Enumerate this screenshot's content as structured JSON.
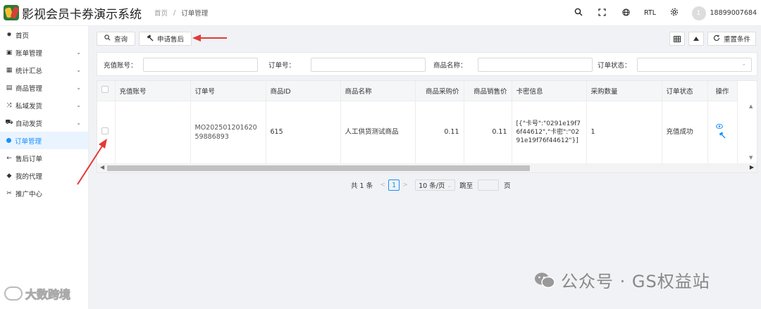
{
  "app": {
    "title": "影视会员卡券演示系统"
  },
  "breadcrumb": {
    "home": "首页",
    "sep": "/",
    "current": "订单管理"
  },
  "topbar": {
    "rtl": "RTL",
    "avatar_text": "1",
    "username": "18899007684"
  },
  "sidebar": {
    "items": [
      {
        "label": "首页",
        "icon": "home-icon",
        "glyph": "✹",
        "expandable": false
      },
      {
        "label": "账单管理",
        "icon": "bill-icon",
        "glyph": "▣",
        "expandable": true
      },
      {
        "label": "统计汇总",
        "icon": "table-icon",
        "glyph": "▦",
        "expandable": true
      },
      {
        "label": "商品管理",
        "icon": "calendar-icon",
        "glyph": "▤",
        "expandable": true
      },
      {
        "label": "私域发货",
        "icon": "shuffle-icon",
        "glyph": "⤨",
        "expandable": true
      },
      {
        "label": "自动发货",
        "icon": "truck-icon",
        "glyph": "⛟",
        "expandable": true
      },
      {
        "label": "订单管理",
        "icon": "dot-icon",
        "glyph": "",
        "expandable": false,
        "active": true
      },
      {
        "label": "售后订单",
        "icon": "arrow-left-icon",
        "glyph": "←",
        "expandable": false
      },
      {
        "label": "我的代理",
        "icon": "tag-icon",
        "glyph": "◆",
        "expandable": false
      },
      {
        "label": "推广中心",
        "icon": "gift-icon",
        "glyph": "✂",
        "expandable": false
      }
    ],
    "chevron": "⌄"
  },
  "toolbar": {
    "query_label": "查询",
    "after_sale_label": "申请售后",
    "reset_label": "重置条件"
  },
  "filters": {
    "account_label": "充值账号：",
    "order_no_label": "订单号：",
    "product_name_label": "商品名称：",
    "status_label": "订单状态："
  },
  "table": {
    "headers": [
      "充值账号",
      "订单号",
      "商品ID",
      "商品名称",
      "商品采购价",
      "商品销售价",
      "卡密信息",
      "采购数量",
      "订单状态",
      "操作"
    ],
    "rows": [
      {
        "account": "",
        "order_no": "MO20250120162059886893",
        "product_id": "615",
        "product_name": "人工供货测试商品",
        "purchase_price": "0.11",
        "sale_price": "0.11",
        "card_info": "[{\"卡号\":\"0291e19f76f44612\",\"卡密\":\"0291e19f76f44612\"}]",
        "quantity": "1",
        "status": "充值成功"
      }
    ]
  },
  "pager": {
    "total": "共 1 条",
    "current_page": "1",
    "page_size": "10 条/页",
    "jump_label": "跳至",
    "page_suffix": "页"
  },
  "watermarks": {
    "right": "公众号 · GS权益站",
    "left": "大数跨境"
  },
  "colors": {
    "accent": "#1890ff",
    "arrow": "#e53935"
  }
}
